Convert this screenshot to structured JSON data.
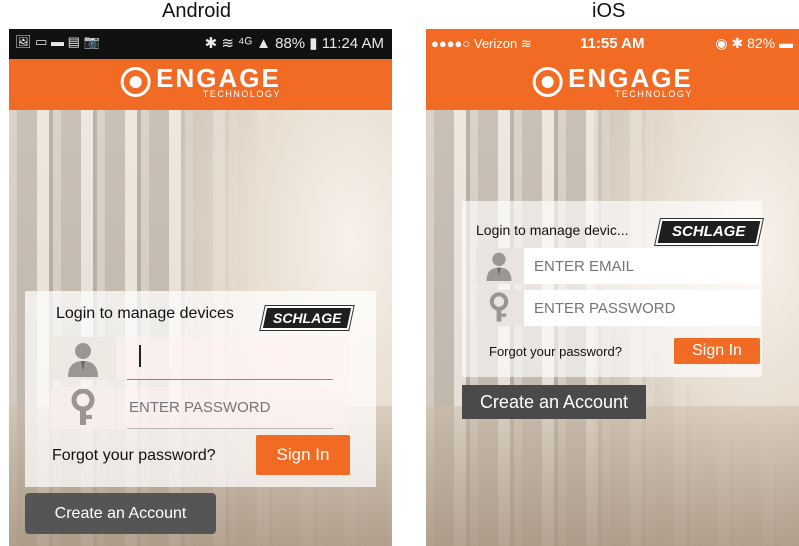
{
  "titles": {
    "android": "Android",
    "ios": "iOS"
  },
  "android": {
    "statusbar": {
      "left_icons": "🖼 ▭ ▬ ▤ 📷",
      "right_text": "✱ ≋ ⁴ᴳ ▲ 88% ▮ 11:24 AM"
    },
    "logo": {
      "word": "ENGAGE",
      "sub": "TECHNOLOGY"
    },
    "login": {
      "title": "Login to manage devices",
      "brand": "SCHLAGE",
      "email_value": "",
      "password_placeholder": "ENTER PASSWORD",
      "forgot": "Forgot your password?",
      "signin": "Sign In"
    },
    "create_account": "Create an Account"
  },
  "ios": {
    "statusbar": {
      "carrier": "●●●●○ Verizon ≋",
      "time": "11:55 AM",
      "right": "◉ ✱ 82% ▬"
    },
    "logo": {
      "word": "ENGAGE",
      "sub": "TECHNOLOGY"
    },
    "login": {
      "title": "Login to manage devic...",
      "brand": "SCHLAGE",
      "email_placeholder": "ENTER EMAIL",
      "password_placeholder": "ENTER PASSWORD",
      "forgot": "Forgot your password?",
      "signin": "Sign In"
    },
    "create_account": "Create an Account"
  },
  "colors": {
    "accent": "#f26b25",
    "dark_button": "#4f4f4f"
  }
}
